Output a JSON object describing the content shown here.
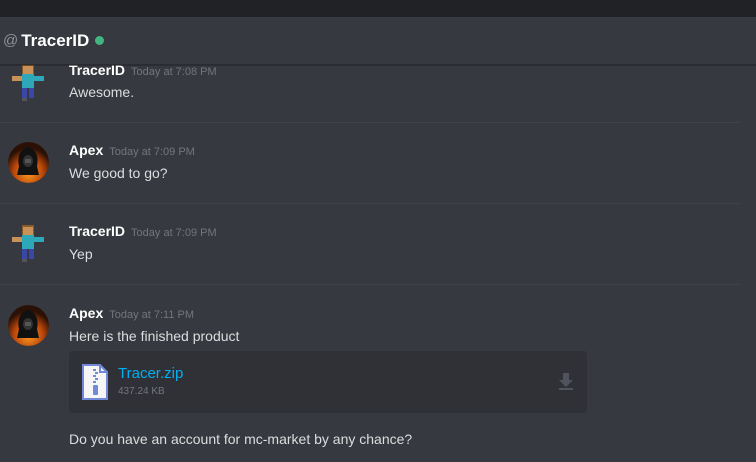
{
  "channel": {
    "at_symbol": "@",
    "name": "TracerID",
    "status_color": "#43b581"
  },
  "messages": [
    {
      "author": "TracerID",
      "timestamp": "Today at 7:08 PM",
      "lines": [
        "Awesome."
      ],
      "avatar_icon": "minecraft-skin-icon"
    },
    {
      "author": "Apex",
      "timestamp": "Today at 7:09 PM",
      "lines": [
        "We good to go?"
      ],
      "avatar_icon": "hooded-figure-avatar-icon"
    },
    {
      "author": "TracerID",
      "timestamp": "Today at 7:09 PM",
      "lines": [
        "Yep"
      ],
      "avatar_icon": "minecraft-skin-icon"
    },
    {
      "author": "Apex",
      "timestamp": "Today at 7:11 PM",
      "lines": [
        "Here is the finished product",
        "Do you have an account for mc-market by any chance?"
      ],
      "avatar_icon": "hooded-figure-avatar-icon",
      "attachment": {
        "file_name": "Tracer.zip",
        "file_size": "437.24 KB",
        "file_icon": "zip-file-icon",
        "download_icon": "download-icon"
      }
    }
  ],
  "colors": {
    "background": "#36393f",
    "accent_link": "#00b0f4",
    "online": "#43b581"
  }
}
